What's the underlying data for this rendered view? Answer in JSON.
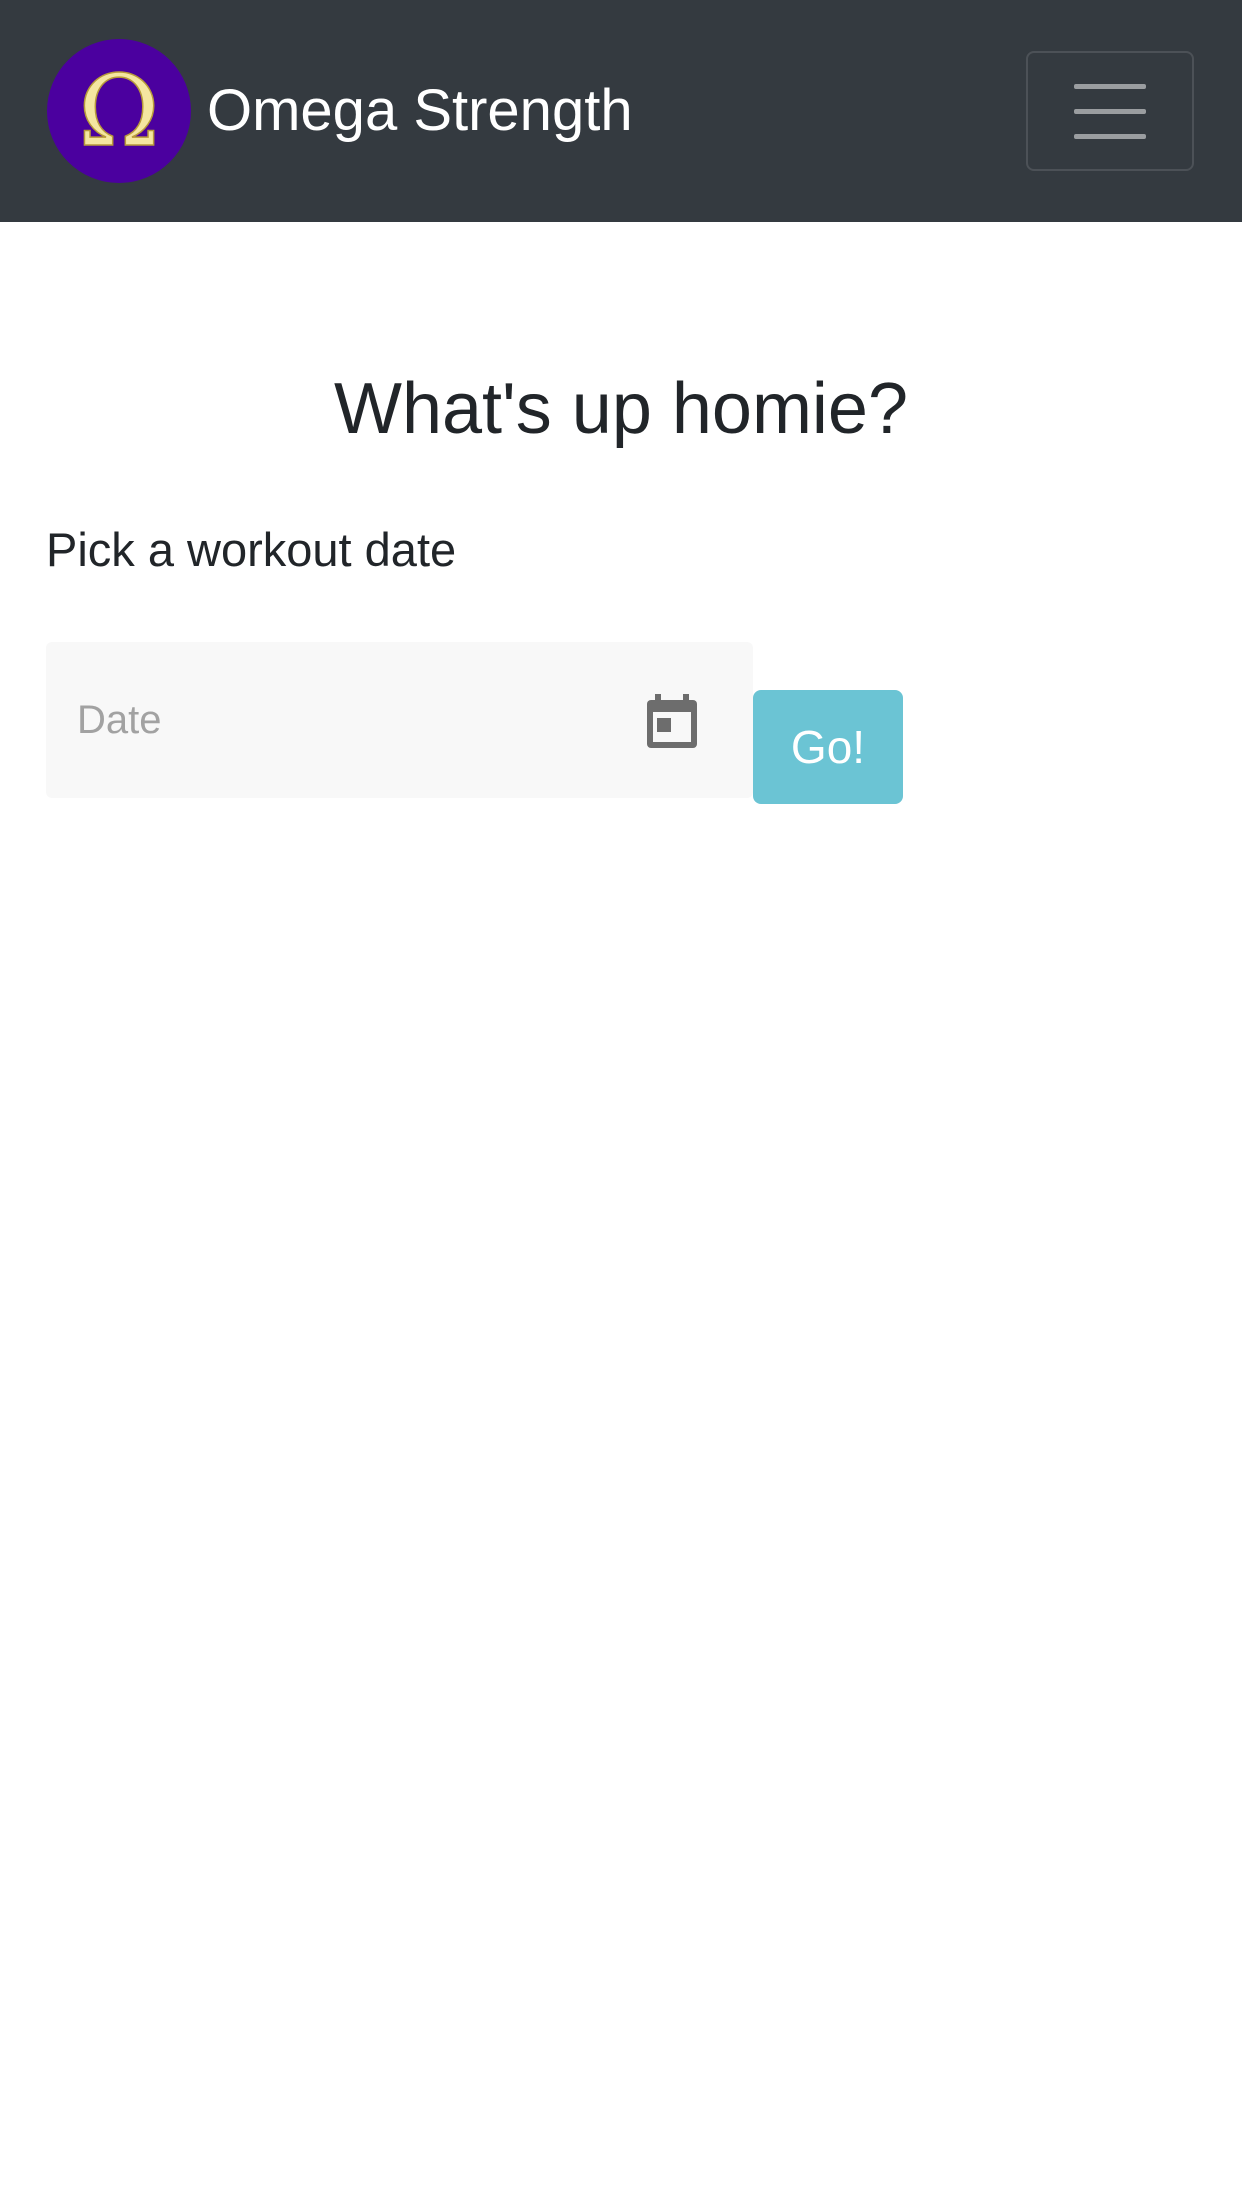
{
  "navbar": {
    "brand_name": "Omega Strength",
    "logo_glyph": "Ω",
    "logo_colors": {
      "background": "#4b009f",
      "glyph": "#f5e6a0"
    },
    "menu_icon": "hamburger-icon",
    "background": "#343a40"
  },
  "main": {
    "heading": "What's up homie?",
    "prompt": "Pick a workout date",
    "date_input": {
      "placeholder": "Date",
      "value": "",
      "icon": "calendar-icon"
    },
    "go_button_label": "Go!"
  },
  "colors": {
    "accent": "#6bc4d4",
    "text": "#212529",
    "input_background": "#f8f8f8"
  }
}
